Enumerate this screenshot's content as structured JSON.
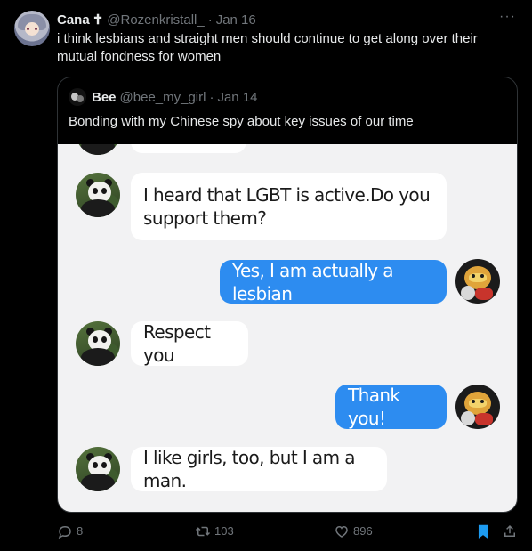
{
  "tweet": {
    "author_name": "Cana",
    "author_badge": "✝",
    "author_handle": "@Rozenkristall_",
    "separator": "·",
    "date": "Jan 16",
    "more_label": "···",
    "text": "i think lesbians and straight men should continue to get along over their mutual fondness for women"
  },
  "quote": {
    "author_name": "Bee",
    "author_handle": "@bee_my_girl",
    "separator": "·",
    "date": "Jan 14",
    "text": "Bonding with my Chinese spy about key issues of our time",
    "chat": {
      "background": "#f2f2f3",
      "incoming_color": "#ffffff",
      "outgoing_color": "#2d8cf0",
      "messages": [
        {
          "side": "incoming",
          "text": "I heard that LGBT is active.Do you support them?"
        },
        {
          "side": "outgoing",
          "text": "Yes, I am actually a lesbian"
        },
        {
          "side": "incoming",
          "text": "Respect you"
        },
        {
          "side": "outgoing",
          "text": "Thank you!"
        },
        {
          "side": "incoming",
          "text": "I like girls, too, but I am a man."
        }
      ]
    }
  },
  "actions": {
    "replies": "8",
    "reposts": "103",
    "likes": "896",
    "bookmark_active_color": "#1d9bf0",
    "icons": [
      "reply-icon",
      "repost-icon",
      "like-icon",
      "bookmark-icon",
      "share-icon"
    ]
  }
}
